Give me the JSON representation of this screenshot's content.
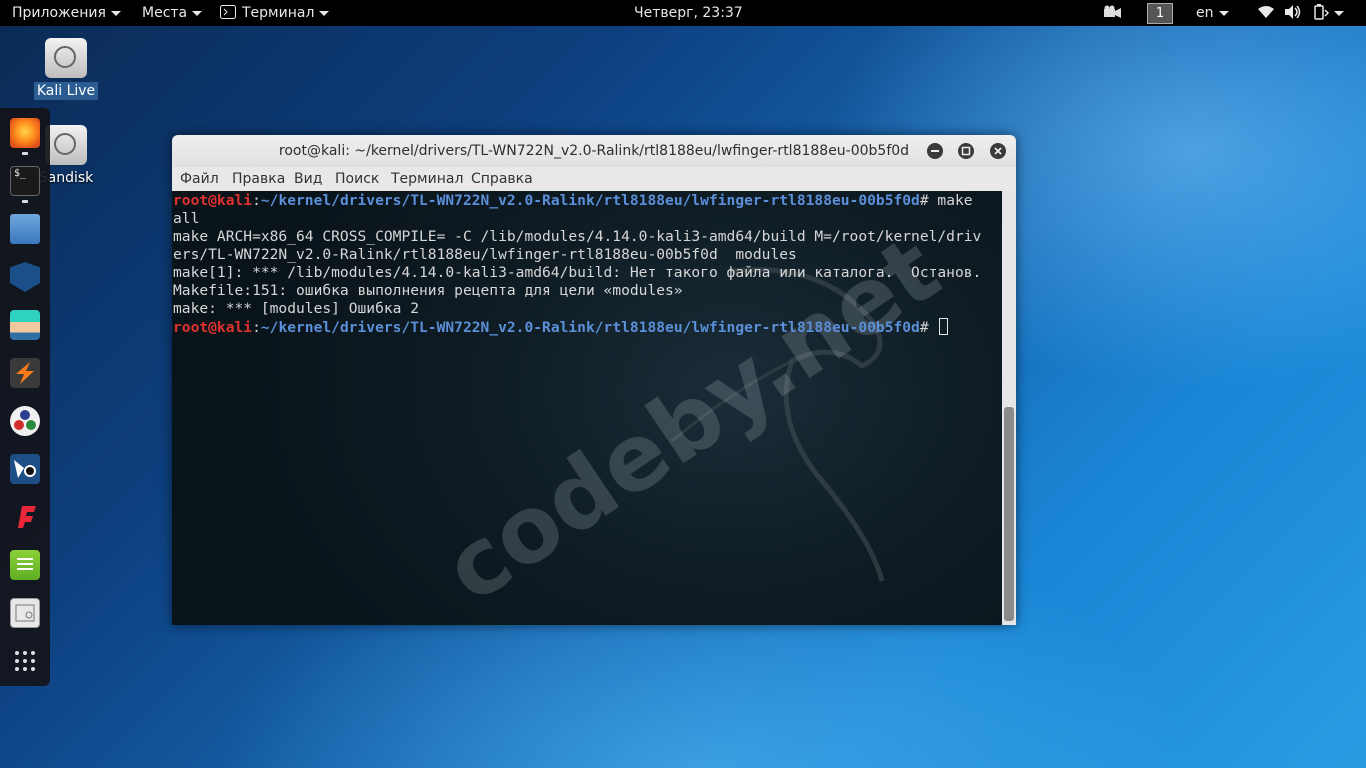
{
  "topbar": {
    "applications": "Приложения",
    "places": "Места",
    "active_app": "Терминал",
    "clock": "Четверг, 23:37",
    "workspace": "1",
    "language": "en"
  },
  "desktop": {
    "icons": [
      {
        "label": "Kali Live",
        "selected": true
      },
      {
        "label": "Sandisk",
        "selected": false
      }
    ]
  },
  "dock": {
    "items": [
      "firefox-icon",
      "terminal-icon",
      "files-icon",
      "metasploit-icon",
      "armitage-icon",
      "burpsuite-icon",
      "maltego-icon",
      "beef-icon",
      "faraday-icon",
      "leafpad-icon",
      "cutycapt-icon",
      "show-applications-icon"
    ]
  },
  "terminal": {
    "title": "root@kali: ~/kernel/drivers/TL-WN722N_v2.0-Ralink/rtl8188eu/lwfinger-rtl8188eu-00b5f0d",
    "menu": [
      "Файл",
      "Правка",
      "Вид",
      "Поиск",
      "Терминал",
      "Справка"
    ],
    "prompt_user": "root@kali",
    "prompt_path": "~/kernel/drivers/TL-WN722N_v2.0-Ralink/rtl8188eu/lwfinger-rtl8188eu-00b5f0d",
    "command1_a": "# make",
    "command1_b": "all",
    "output": [
      "make ARCH=x86_64 CROSS_COMPILE= -C /lib/modules/4.14.0-kali3-amd64/build M=/root/kernel/driv",
      "ers/TL-WN722N_v2.0-Ralink/rtl8188eu/lwfinger-rtl8188eu-00b5f0d  modules",
      "make[1]: *** /lib/modules/4.14.0-kali3-amd64/build: Нет такого файла или каталога.  Останов.",
      "Makefile:151: ошибка выполнения рецепта для цели «modules»",
      "make: *** [modules] Ошибка 2"
    ],
    "prompt_suffix": "# ",
    "watermark": "codeby.net"
  }
}
